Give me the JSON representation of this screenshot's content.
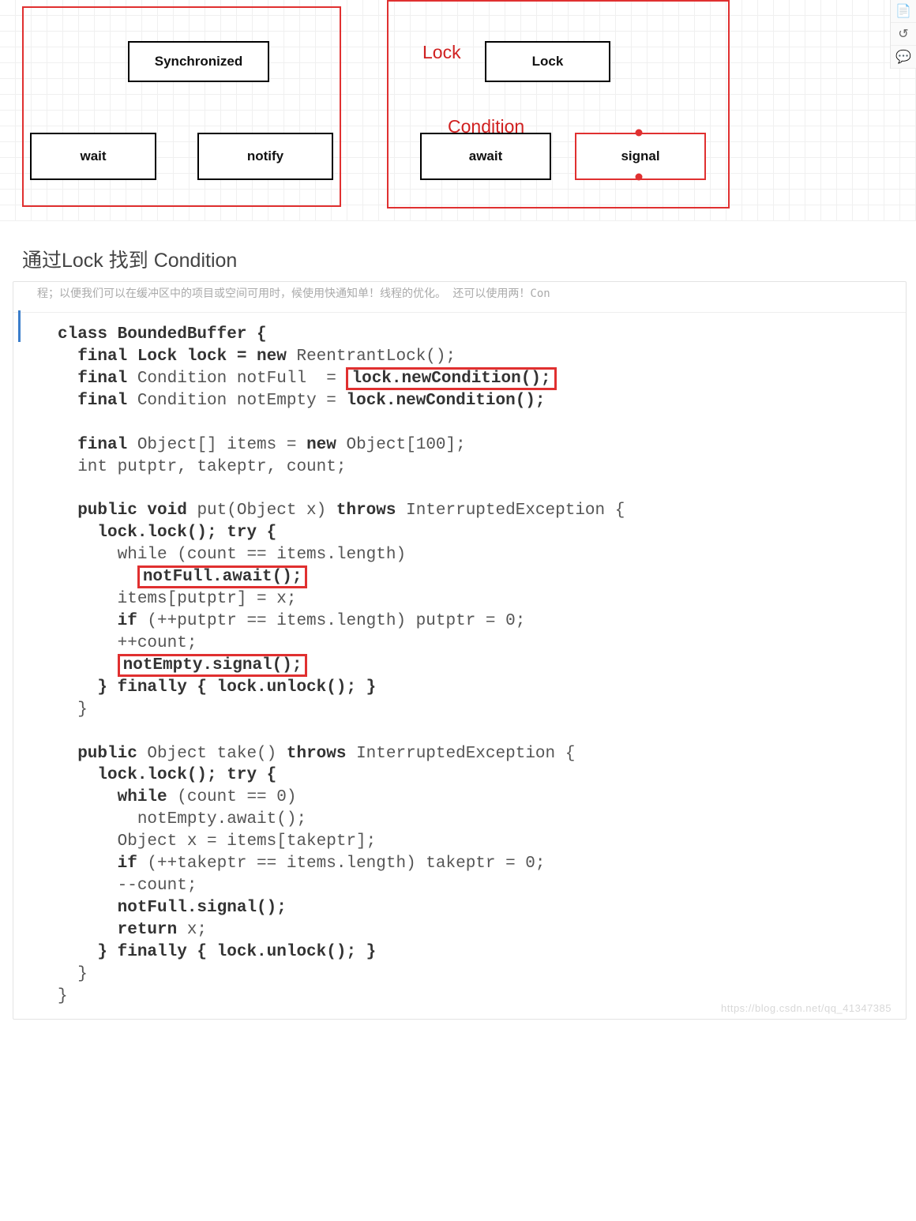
{
  "diagram": {
    "sync": "Synchronized",
    "wait": "wait",
    "notify": "notify",
    "lockTitle": "Lock",
    "lockNode": "Lock",
    "conditionTitle": "Condition",
    "await": "await",
    "signal": "signal"
  },
  "heading": "通过Lock 找到 Condition",
  "codeStrip": "程；以便我们可以在缓冲区中的项目或空间可用时，候使用快通知单！线程的优化。   还可以使用两！Con",
  "code": {
    "l01a": "class BoundedBuffer {",
    "l02a": "  final Lock lock = ",
    "l02b": "new ",
    "l02c": "ReentrantLock();",
    "l03a": "  final ",
    "l03b": "Condition notFull  = ",
    "l03hl": "lock.newCondition();",
    "l04a": "  final ",
    "l04b": "Condition notEmpty = ",
    "l04c": "lock.newCondition();",
    "l06a": "  final ",
    "l06b": "Object[] items = ",
    "l06c": "new ",
    "l06d": "Object[100];",
    "l07": "  int putptr, takeptr, count;",
    "l09a": "  public void ",
    "l09b": "put(Object x) ",
    "l09c": "throws ",
    "l09d": "InterruptedException {",
    "l10a": "    lock.lock(); try {",
    "l11": "      while (count == items.length)",
    "l12hl": "notFull.await();",
    "l13": "      items[putptr] = x;",
    "l14a": "      if ",
    "l14b": "(++putptr == items.length) putptr = 0;",
    "l15": "      ++count;",
    "l16hl": "notEmpty.signal();",
    "l17a": "    } finally { lock.unlock(); }",
    "l18": "  }",
    "l20a": "  public ",
    "l20b": "Object take() ",
    "l20c": "throws ",
    "l20d": "InterruptedException {",
    "l21a": "    lock.lock(); try {",
    "l22a": "      while ",
    "l22b": "(count == 0)",
    "l23": "        notEmpty.await();",
    "l24": "      Object x = items[takeptr];",
    "l25a": "      if ",
    "l25b": "(++takeptr == items.length) takeptr = 0;",
    "l26": "      --count;",
    "l27a": "      notFull.signal();",
    "l28a": "      return ",
    "l28b": "x;",
    "l29a": "    } finally { lock.unlock(); }",
    "l30": "  }",
    "l31": "}"
  },
  "watermark": "https://blog.csdn.net/qq_41347385"
}
